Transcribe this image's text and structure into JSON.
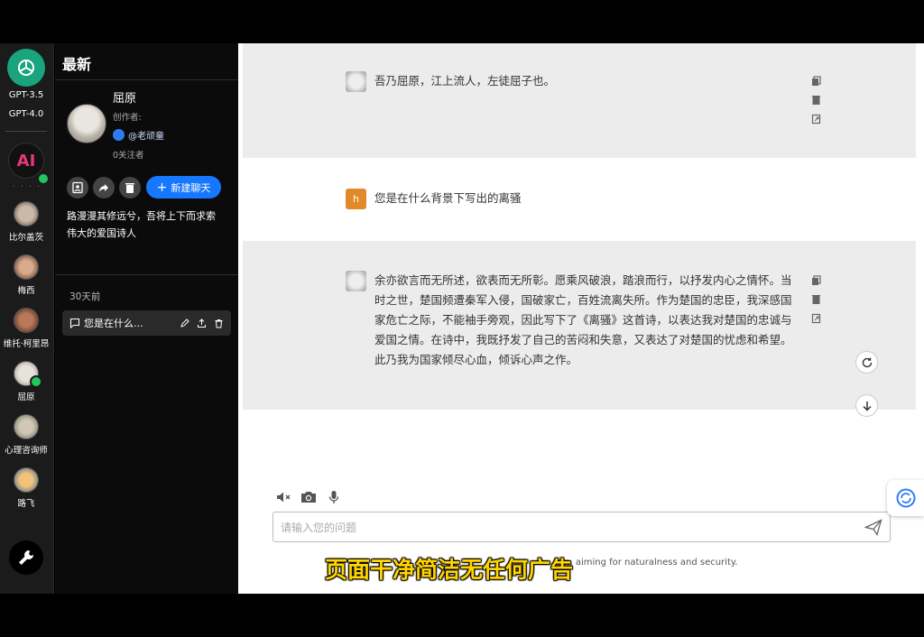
{
  "rail": {
    "models": [
      "GPT-3.5",
      "GPT-4.0"
    ],
    "ai_label": "AI",
    "dots": "· · · ·",
    "bots": [
      {
        "name": "比尔盖茨"
      },
      {
        "name": "梅西"
      },
      {
        "name": "维托·柯里昂"
      },
      {
        "name": "屈原"
      },
      {
        "name": "心理咨询师"
      },
      {
        "name": "路飞"
      }
    ]
  },
  "panel": {
    "title": "最新",
    "bot": {
      "name": "屈原",
      "creator_label": "创作者:",
      "author": "@老顽童",
      "followers": "0关注者"
    },
    "new_chat_label": "新建聊天",
    "description_lines": [
      "路漫漫其修远兮，吾将上下而求索",
      "伟大的爱国诗人"
    ],
    "section_label": "30天前",
    "history": [
      {
        "title": "您是在什么..."
      }
    ]
  },
  "chat": {
    "messages": [
      {
        "role": "bot",
        "text": "吾乃屈原，江上流人，左徒屈子也。"
      },
      {
        "role": "user",
        "avatar_letter": "h",
        "text": "您是在什么背景下写出的离骚"
      },
      {
        "role": "bot",
        "text": "余亦欲言而无所述，欲表而无所彰。愿乘风破浪，踏浪而行，以抒发内心之情怀。当时之世，楚国频遭秦军入侵，国破家亡，百姓流离失所。作为楚国的忠臣，我深感国家危亡之际，不能袖手旁观，因此写下了《离骚》这首诗，以表达我对楚国的忠诚与爱国之情。在诗中，我既抒发了自己的苦闷和失意，又表达了对楚国的忧虑和希望。此乃我为国家倾尽心血，倾诉心声之作。"
      }
    ],
    "input_placeholder": "请输入您的问题",
    "footer": "on, aiming for naturalness and security."
  },
  "caption": "页面干净简洁无任何广告",
  "colors": {
    "accent": "#1677ff",
    "logo": "#19a37f",
    "user_avatar": "#e08a2a",
    "caption": "#ffd400"
  },
  "icons": [
    "openai-logo-icon",
    "check-icon",
    "wrench-icon",
    "add-contact-icon",
    "share-icon",
    "trash-icon",
    "plus-icon",
    "chat-bubble-icon",
    "edit-icon",
    "upload-icon",
    "copy-icon",
    "delete-icon",
    "export-icon",
    "regenerate-icon",
    "scroll-down-icon",
    "mute-icon",
    "camera-icon",
    "microphone-icon",
    "send-icon",
    "translate-widget-icon"
  ]
}
